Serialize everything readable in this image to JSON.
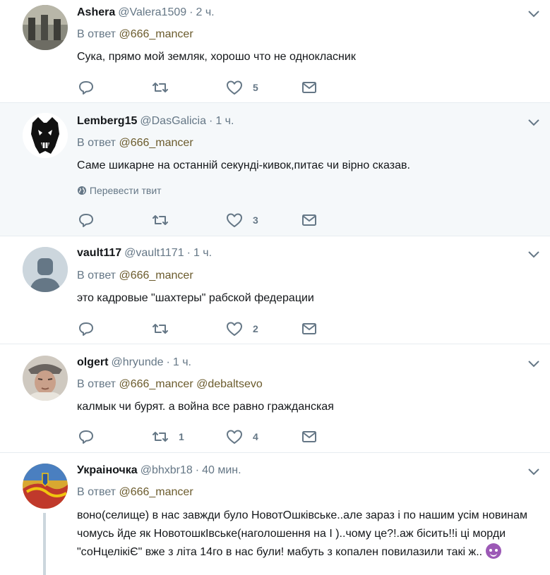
{
  "reply_to_label": "В ответ",
  "translate_label": "Перевести твит",
  "tweets": [
    {
      "name": "Ashera",
      "handle": "@Valera1509",
      "time": "2 ч.",
      "reply_to": [
        "@666_mancer"
      ],
      "text": "Сука, прямо мой земляк, хорошо что не однокласник",
      "reply_count": "",
      "retweet_count": "",
      "like_count": "5"
    },
    {
      "name": "Lemberg15",
      "handle": "@DasGalicia",
      "time": "1 ч.",
      "reply_to": [
        "@666_mancer"
      ],
      "text": "Саме шикарне на останній секунді-кивок,питає чи вірно сказав.",
      "reply_count": "",
      "retweet_count": "",
      "like_count": "3"
    },
    {
      "name": "vault117",
      "handle": "@vault1171",
      "time": "1 ч.",
      "reply_to": [
        "@666_mancer"
      ],
      "text": "это кадровые \"шахтеры\" рабской федерации",
      "reply_count": "",
      "retweet_count": "",
      "like_count": "2"
    },
    {
      "name": "olgert",
      "handle": "@hryunde",
      "time": "1 ч.",
      "reply_to": [
        "@666_mancer",
        "@debaltsevo"
      ],
      "text": "калмык  чи бурят. а война все равно гражданская",
      "reply_count": "",
      "retweet_count": "1",
      "like_count": "4"
    },
    {
      "name": "Украiночка",
      "handle": "@bhxbr18",
      "time": "40 мин.",
      "reply_to": [
        "@666_mancer"
      ],
      "text": "воно(селище) в нас завжди було НовотОшківське..але зараз і по нашим усім новинам чомусь йде як НовотошкІвське(наголошення  на І )..чому це?!.аж бісить!!і ці морди \"соНцелікіЄ\" вже з літа 14го в нас були! мабуть з копален повилазили такі ж.."
    }
  ],
  "colors": {
    "link": "#6b5b2c",
    "muted": "#657786",
    "highlight_bg": "#f5f8fa"
  }
}
